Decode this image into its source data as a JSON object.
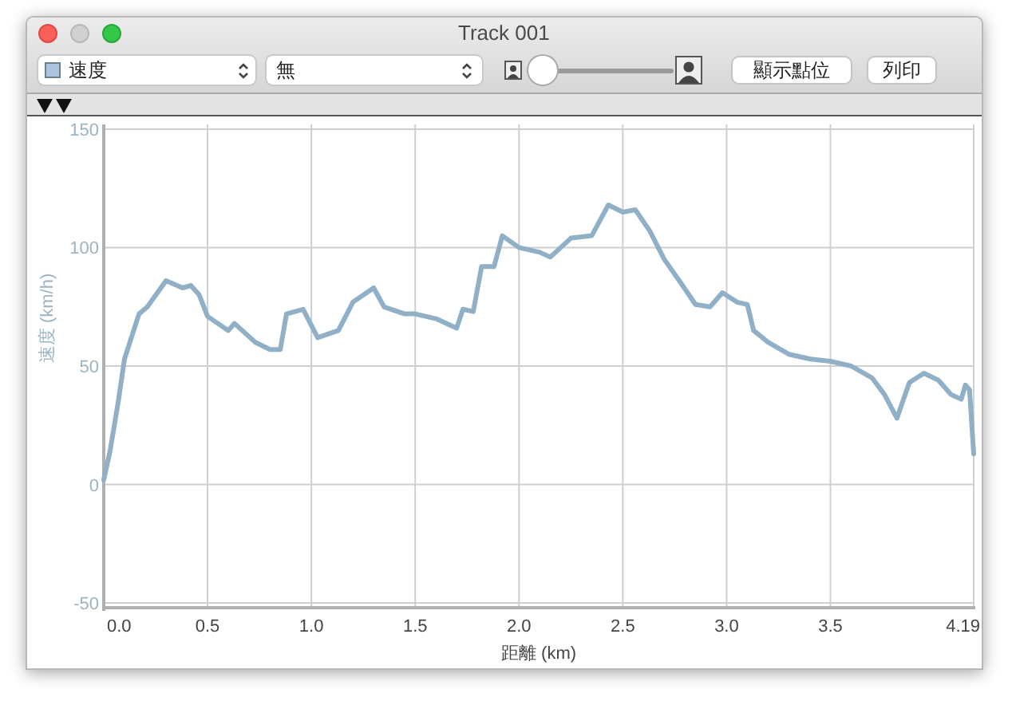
{
  "window": {
    "title": "Track 001"
  },
  "toolbar": {
    "series_menu": {
      "label": "速度",
      "color": "#a9c4dc"
    },
    "compare_menu": {
      "label": "無"
    },
    "zoom_slider": {
      "level": 0.02
    },
    "buttons": [
      "顯示點位",
      "列印"
    ]
  },
  "markers": [
    {
      "kind": "triangle"
    },
    {
      "kind": "triangle"
    }
  ],
  "chart_data": {
    "type": "line",
    "grid": true,
    "xlabel": "距離 (km)",
    "ylabel": "速度 (km/h)",
    "xlim": [
      0,
      4.19
    ],
    "ylim": [
      -52,
      152
    ],
    "xticks": [
      {
        "value": 0,
        "label": "0.0"
      },
      {
        "value": 0.5,
        "label": "0.5"
      },
      {
        "value": 1,
        "label": "1.0"
      },
      {
        "value": 1.5,
        "label": "1.5"
      },
      {
        "value": 2,
        "label": "2.0"
      },
      {
        "value": 2.5,
        "label": "2.5"
      },
      {
        "value": 3,
        "label": "3.0"
      },
      {
        "value": 3.5,
        "label": "3.5"
      },
      {
        "value": 4.19,
        "label": "4.19"
      }
    ],
    "yticks": [
      -50,
      0,
      50,
      100,
      150
    ],
    "x": [
      0,
      0.03,
      0.07,
      0.1,
      0.17,
      0.21,
      0.3,
      0.38,
      0.42,
      0.46,
      0.5,
      0.55,
      0.6,
      0.63,
      0.68,
      0.73,
      0.8,
      0.85,
      0.88,
      0.96,
      1.03,
      1.13,
      1.2,
      1.3,
      1.35,
      1.45,
      1.5,
      1.6,
      1.7,
      1.73,
      1.78,
      1.82,
      1.88,
      1.92,
      2.0,
      2.1,
      2.15,
      2.25,
      2.35,
      2.43,
      2.5,
      2.56,
      2.63,
      2.7,
      2.78,
      2.85,
      2.92,
      2.98,
      3.05,
      3.1,
      3.13,
      3.2,
      3.3,
      3.4,
      3.5,
      3.6,
      3.7,
      3.76,
      3.82,
      3.88,
      3.95,
      4.02,
      4.08,
      4.13,
      4.15,
      4.17,
      4.19
    ],
    "series": [
      {
        "color": "#8fb0c6",
        "values": [
          2,
          14,
          35,
          53,
          72,
          75,
          86,
          83,
          84,
          80,
          71,
          68,
          65,
          68,
          64,
          60,
          57,
          57,
          72,
          74,
          62,
          65,
          77,
          83,
          75,
          72,
          72,
          70,
          66,
          74,
          73,
          92,
          92,
          105,
          100,
          98,
          96,
          104,
          105,
          118,
          115,
          116,
          107,
          95,
          85,
          76,
          75,
          81,
          77,
          76,
          65,
          60,
          55,
          53,
          52,
          50,
          45,
          38,
          28,
          43,
          47,
          44,
          38,
          36,
          42,
          40,
          13
        ]
      }
    ]
  }
}
